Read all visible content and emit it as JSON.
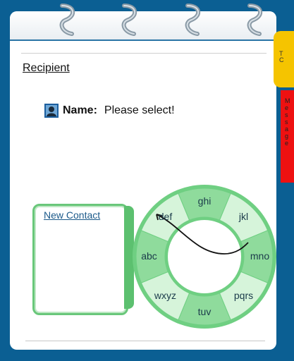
{
  "header": {
    "recipient_label": "Recipient"
  },
  "name_field": {
    "label": "Name:",
    "value": "Please select!"
  },
  "side_tabs": {
    "yellow_text": "T\nC",
    "red_text": "M\ne\ns\ns\na\ng\ne"
  },
  "contact": {
    "new_contact_label": "New Contact"
  },
  "dial": {
    "segments": [
      "ghi",
      "jkl",
      "mno",
      "pqrs",
      "tuv",
      "wxyz",
      "abc",
      "def"
    ]
  },
  "colors": {
    "frame": "#0b5f93",
    "accent_green": "#69c77a",
    "tab_yellow": "#f5c400",
    "tab_red": "#ee1111"
  }
}
